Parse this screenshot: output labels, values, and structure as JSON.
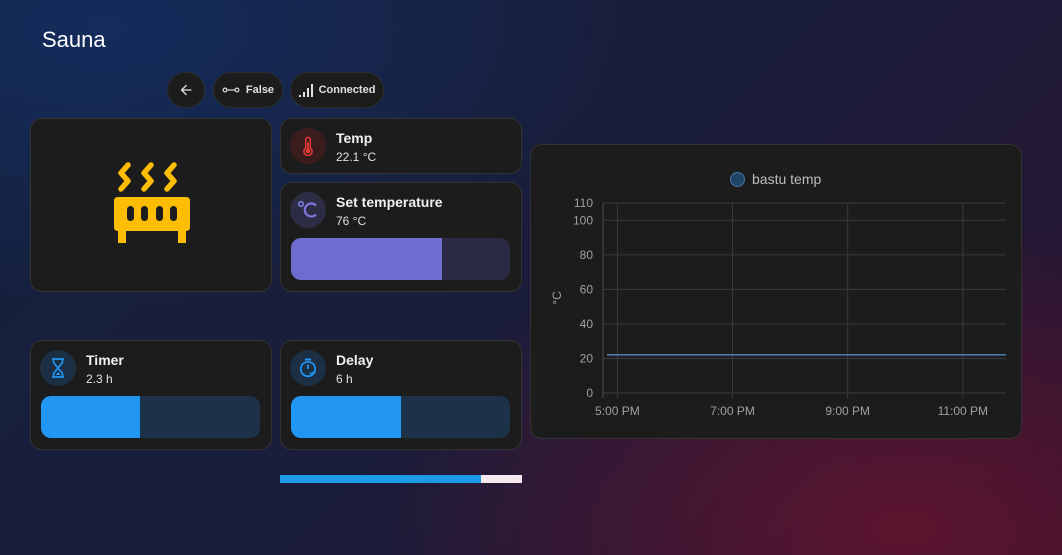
{
  "page": {
    "title": "Sauna"
  },
  "chips": {
    "back_icon": "arrow-left-icon",
    "status_label": "False",
    "status_icon": "connection-icon",
    "connection_label": "Connected",
    "connection_icon": "signal-bars-icon"
  },
  "hero": {
    "icon": "sauna-heater-icon",
    "color": "#fdbd04"
  },
  "temp": {
    "name": "Temp",
    "value": "22.1 °C",
    "icon": "thermometer-icon",
    "color": "#e53935"
  },
  "set_temperature": {
    "name": "Set temperature",
    "value": "76 °C",
    "icon": "celsius-icon",
    "level": 0.69,
    "color": "#6e6ccf"
  },
  "timer": {
    "name": "Timer",
    "value": "2.3 h",
    "icon": "hourglass-icon",
    "level": 0.45,
    "color": "#2196f3"
  },
  "delay": {
    "name": "Delay",
    "value": "6 h",
    "icon": "timer-check-icon",
    "level": 0.5,
    "color": "#2196f3"
  },
  "progress": {
    "level": 0.83,
    "color": "#1e9be8"
  },
  "chart_data": {
    "type": "line",
    "series": [
      {
        "name": "bastu temp",
        "color": "#4a78a8",
        "values": [
          22.1,
          22.1,
          22.1,
          22.1,
          22.1,
          22.1,
          22.1,
          22.1
        ]
      }
    ],
    "x": [
      "4:45 PM",
      "5:00 PM",
      "7:00 PM",
      "9:00 PM",
      "11:00 PM",
      "11:45 PM"
    ],
    "xticks": [
      "5:00 PM",
      "7:00 PM",
      "9:00 PM",
      "11:00 PM"
    ],
    "yticks": [
      "0",
      "20",
      "40",
      "60",
      "80",
      "100",
      "110"
    ],
    "ylabel": "°C",
    "ylim": [
      0,
      110
    ],
    "grid": true,
    "legend": "top"
  }
}
